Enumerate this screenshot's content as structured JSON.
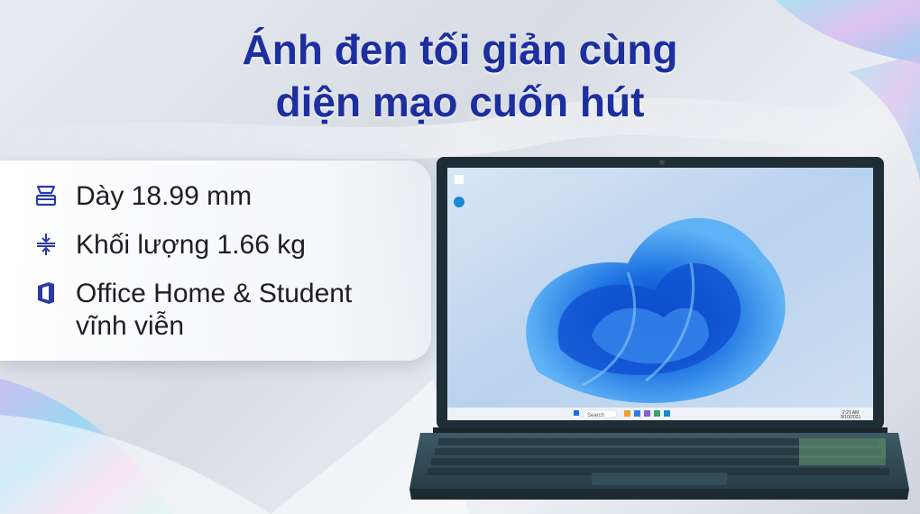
{
  "headline": {
    "line1": "Ánh đen tối giản cùng",
    "line2": "diện mạo cuốn hút"
  },
  "specs": [
    {
      "icon": "thickness-icon",
      "text": "Dày 18.99 mm"
    },
    {
      "icon": "weight-icon",
      "text": "Khối lượng 1.66 kg"
    },
    {
      "icon": "office-icon",
      "text_line1": "Office Home & Student",
      "text_line2": "vĩnh viễn"
    }
  ],
  "laptop": {
    "taskbar_search": "Search",
    "clock_time": "2:21 AM",
    "clock_date": "9/10/2021"
  },
  "colors": {
    "headline": "#1d2f9e",
    "icon": "#2a3aa8",
    "wallpaper": "#1a6fe0",
    "laptop_body": "#2f4a57"
  }
}
